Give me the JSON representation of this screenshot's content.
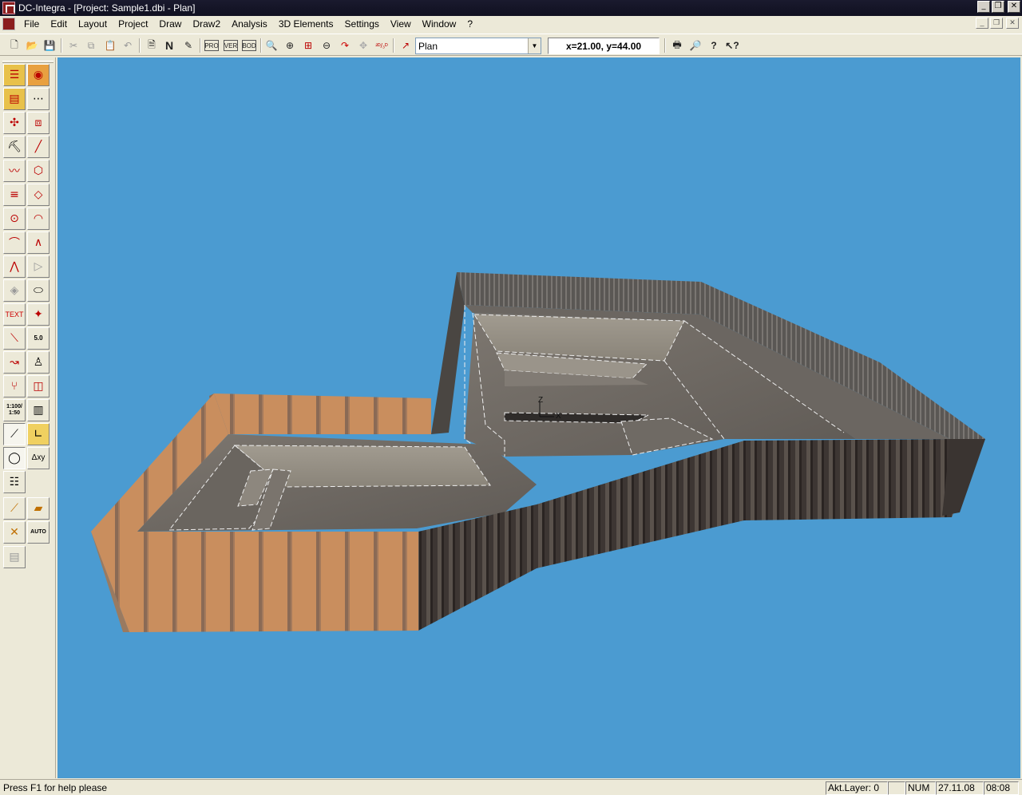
{
  "window": {
    "title": "DC-Integra - [Project: Sample1.dbi - Plan]",
    "controls": {
      "minimize": "_",
      "restore": "❐",
      "close": "✕"
    }
  },
  "menu": {
    "items": [
      "File",
      "Edit",
      "Layout",
      "Project",
      "Draw",
      "Draw2",
      "Analysis",
      "3D Elements",
      "Settings",
      "View",
      "Window",
      "?"
    ]
  },
  "toolbar": {
    "view_selector": {
      "value": "Plan"
    },
    "coordinates": "x=21.00, y=44.00",
    "icons": [
      "new-file-icon",
      "open-folder-icon",
      "save-icon",
      "cut-icon",
      "copy-icon",
      "paste-icon",
      "undo-icon",
      "document-icon",
      "north-icon",
      "pencil-icon",
      "profile-icon",
      "bedding-icon",
      "ground-icon",
      "zoom-icon",
      "zoom-in-icon",
      "zoom-window-icon",
      "zoom-out-icon",
      "redraw-icon",
      "pan-icon",
      "view-2d-3d-icon",
      "line-arrow-icon",
      "print-icon",
      "print-preview-icon",
      "help-icon",
      "context-help-icon"
    ]
  },
  "palette": {
    "labels": {
      "text_tool": "TEXT",
      "dim_tool": "5.0",
      "scale_tool": "1:100/ 1:50",
      "delta_tool": "Δxy",
      "auto_tool": "AUTO"
    }
  },
  "statusbar": {
    "help": "Press F1 for help please",
    "layer": "Akt.Layer: 0",
    "num": "NUM",
    "date": "27.11.08",
    "time": "08:08"
  },
  "colors": {
    "viewport_background": "#4b9bd1",
    "timber_wall": "#c98e5e",
    "sheet_pile_wall": "#4a4440",
    "excavation_floor": "#6f6a64"
  }
}
